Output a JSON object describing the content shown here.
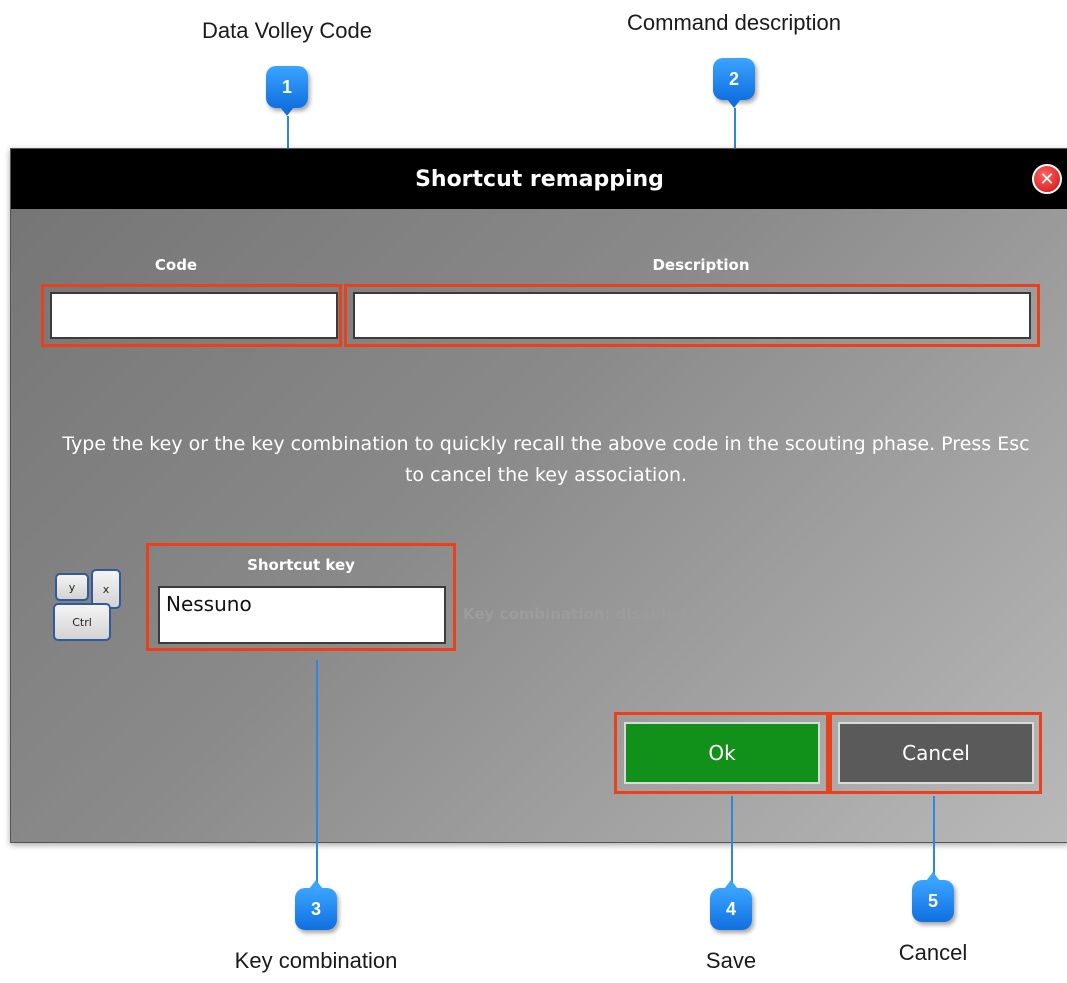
{
  "callouts": [
    {
      "number": "1",
      "label": "Data Volley Code"
    },
    {
      "number": "2",
      "label": "Command description"
    },
    {
      "number": "3",
      "label": "Key combination"
    },
    {
      "number": "4",
      "label": "Save"
    },
    {
      "number": "5",
      "label": "Cancel"
    }
  ],
  "dialog": {
    "title": "Shortcut remapping",
    "close_icon": "close-icon",
    "close_glyph": "✕",
    "code_label": "Code",
    "code_value": "",
    "description_label": "Description",
    "description_value": "",
    "instructions": "Type the key or the key combination to quickly recall the above code in the scouting phase. Press Esc to cancel the key association.",
    "shortcut_label": "Shortcut key",
    "shortcut_value": "Nessuno",
    "key_status": "Key combination: disabled",
    "ok_label": "Ok",
    "cancel_label": "Cancel",
    "keyboard_icon_keys": [
      "y",
      "x",
      "Ctrl"
    ]
  },
  "colors": {
    "highlight": "#e8421c",
    "ok_button": "#12911a",
    "cancel_button": "#5a5a5a",
    "badge": "#1f86f0",
    "titlebar": "#000000"
  }
}
